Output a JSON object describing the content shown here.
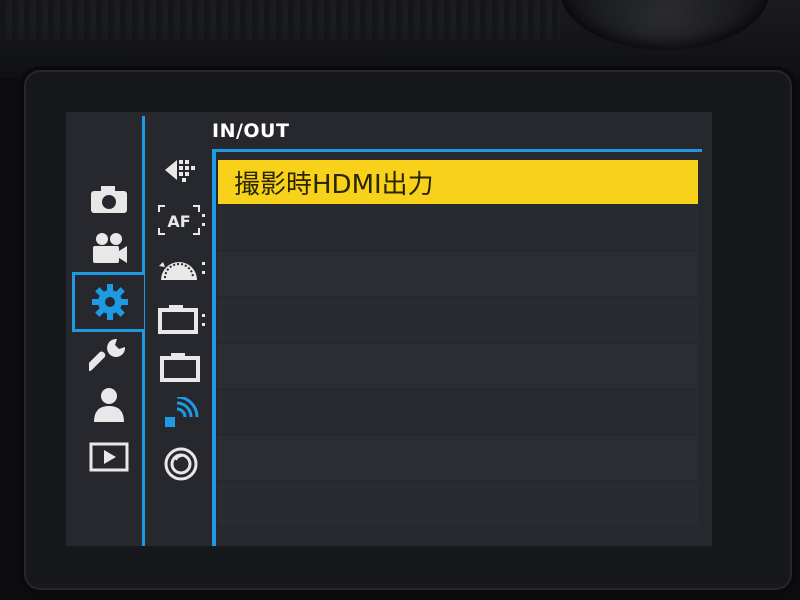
{
  "menu": {
    "title": "IN/OUT",
    "items": [
      {
        "label": "撮影時HDMI出力",
        "selected": true
      },
      {
        "label": "",
        "selected": false
      },
      {
        "label": "",
        "selected": false
      },
      {
        "label": "",
        "selected": false
      },
      {
        "label": "",
        "selected": false
      },
      {
        "label": "",
        "selected": false
      },
      {
        "label": "",
        "selected": false
      },
      {
        "label": "",
        "selected": false
      }
    ]
  },
  "categories": [
    {
      "icon": "camera-icon"
    },
    {
      "icon": "movie-camera-icon"
    },
    {
      "icon": "gear-icon",
      "selected": true
    },
    {
      "icon": "wrench-icon"
    },
    {
      "icon": "person-icon"
    },
    {
      "icon": "playback-icon"
    }
  ],
  "subtabs": [
    {
      "icon": "drive-mode-icon"
    },
    {
      "icon": "af-settings-icon",
      "text": "AF"
    },
    {
      "icon": "dial-icon"
    },
    {
      "icon": "camera-setting-a-icon"
    },
    {
      "icon": "camera-setting-b-icon"
    },
    {
      "icon": "wireless-icon",
      "selected": true
    },
    {
      "icon": "lens-icon"
    }
  ],
  "colors": {
    "accent": "#1e9ae3",
    "highlight": "#f8d21a",
    "screen_bg": "#27282e",
    "icon": "#e8e8e8"
  }
}
